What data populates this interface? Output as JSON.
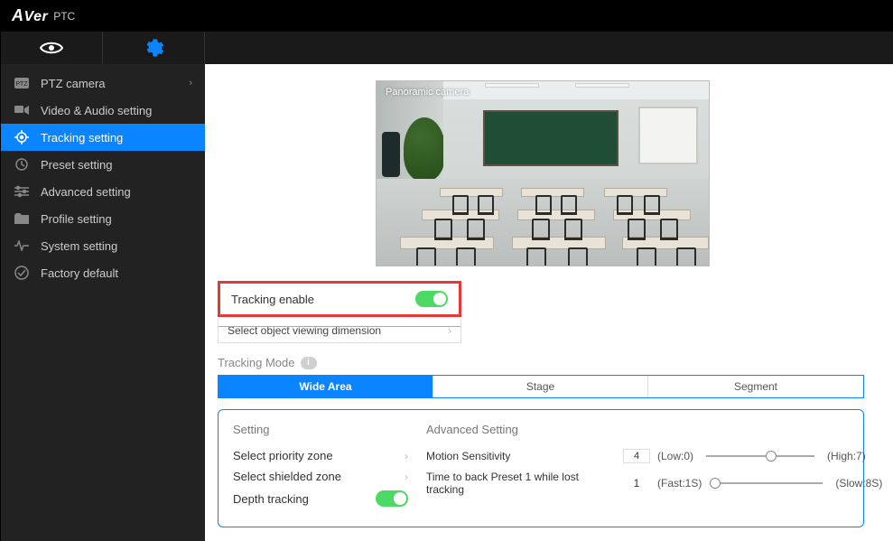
{
  "header": {
    "brand": "AVer",
    "suffix": "PTC"
  },
  "sidebar": {
    "items": [
      {
        "label": "PTZ camera",
        "icon": "ptz-icon",
        "hasSub": true
      },
      {
        "label": "Video & Audio setting",
        "icon": "media-icon"
      },
      {
        "label": "Tracking setting",
        "icon": "target-icon",
        "active": true
      },
      {
        "label": "Preset setting",
        "icon": "preset-icon"
      },
      {
        "label": "Advanced setting",
        "icon": "sliders-icon"
      },
      {
        "label": "Profile setting",
        "icon": "folder-icon"
      },
      {
        "label": "System setting",
        "icon": "pulse-icon"
      },
      {
        "label": "Factory default",
        "icon": "check-circle-icon"
      }
    ]
  },
  "preview": {
    "label": "Panoramic camera"
  },
  "tracking": {
    "enable_label": "Tracking enable",
    "enable_on": true,
    "dimension_label": "Select object viewing dimension",
    "mode_label": "Tracking Mode",
    "modes": [
      "Wide Area",
      "Stage",
      "Segment"
    ],
    "active_mode": 0
  },
  "setting": {
    "title": "Setting",
    "rows": [
      "Select priority zone",
      "Select shielded zone",
      "Depth tracking"
    ],
    "depth_on": true
  },
  "advanced": {
    "title": "Advanced Setting",
    "motion_label": "Motion Sensitivity",
    "motion_value": "4",
    "motion_low": "(Low:0)",
    "motion_high": "(High:7)",
    "time_label": "Time to back Preset 1 while lost tracking",
    "time_value": "1",
    "time_fast": "(Fast:1S)",
    "time_slow": "(Slow:8S)"
  }
}
